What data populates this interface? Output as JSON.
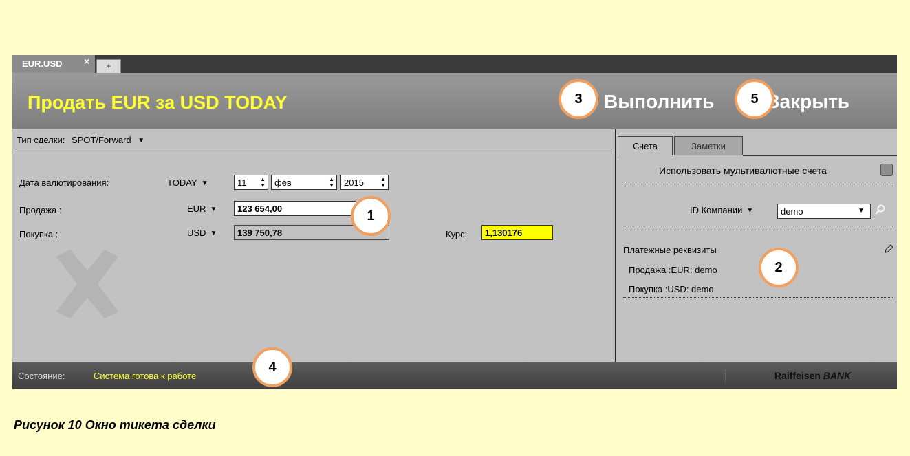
{
  "tab": {
    "label": "EUR.USD",
    "close_glyph": "×",
    "add_glyph": "+"
  },
  "header": {
    "title": "Продать EUR за USD TODAY",
    "execute_label": "Выполнить",
    "close_label": "Закрыть"
  },
  "deal": {
    "type_label": "Тип сделки:",
    "type_value": "SPOT/Forward",
    "value_date_label": "Дата валютирования:",
    "value_date_mode": "TODAY",
    "day": "11",
    "month": "фев",
    "year": "2015",
    "sell_label": "Продажа :",
    "sell_currency": "EUR",
    "sell_amount": "123 654,00",
    "buy_label": "Покупка :",
    "buy_currency": "USD",
    "buy_amount": "139 750,78",
    "rate_label": "Курс:",
    "rate_value": "1,130176"
  },
  "right_panel": {
    "tabs": [
      "Счета",
      "Заметки"
    ],
    "multi_currency_label": "Использовать мультивалютные счета",
    "company_id_label": "ID Компании",
    "company_id_value": "demo",
    "payment_details_label": "Платежные реквизиты",
    "payment_sell": "Продажа :EUR: demo",
    "payment_buy": "Покупка :USD: demo"
  },
  "status": {
    "label": "Состояние:",
    "text": "Система готова к работе",
    "brand_a": "Raiffeisen",
    "brand_b": "BANK"
  },
  "badges": [
    "1",
    "2",
    "3",
    "4",
    "5"
  ],
  "caption": "Рисунок 10 Окно тикета сделки",
  "colors": {
    "page_bg": "#fffdc9",
    "title_yellow": "#ffff33",
    "rate_highlight": "#ffff00",
    "badge_ring": "#f0a060"
  }
}
